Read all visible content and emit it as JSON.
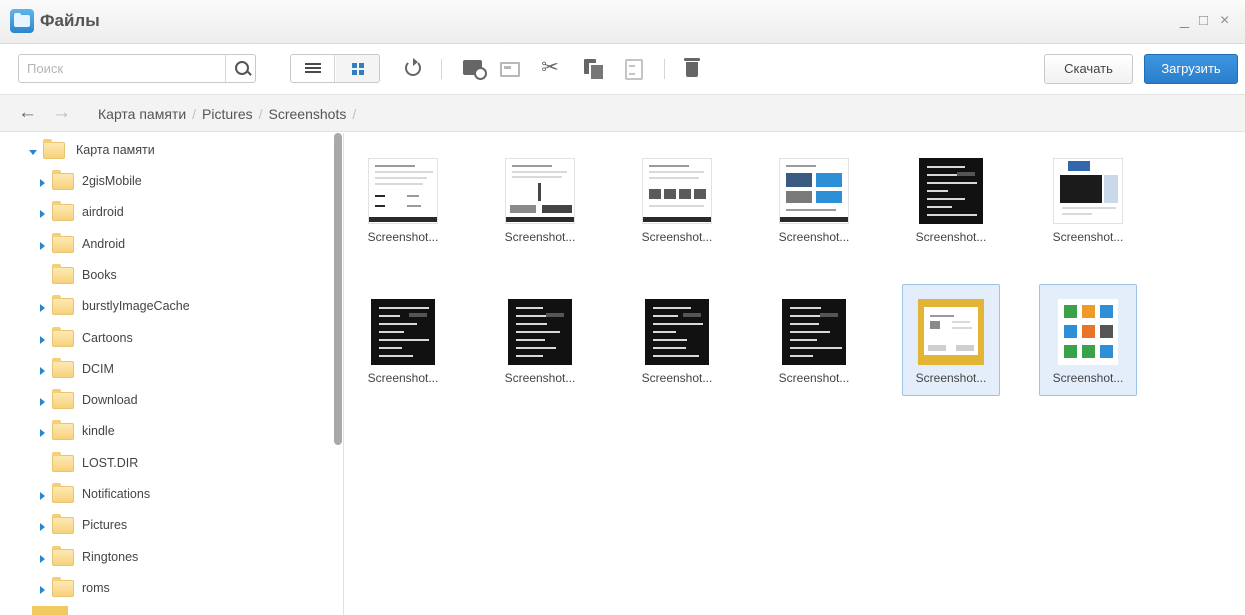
{
  "window": {
    "title": "Файлы",
    "minimize": "_",
    "maximize": "□",
    "close": "×"
  },
  "toolbar": {
    "search_placeholder": "Поиск",
    "download_label": "Скачать",
    "upload_label": "Загрузить",
    "cut_glyph": "✂"
  },
  "nav": {
    "back": "←",
    "forward": "→",
    "breadcrumb": [
      "Карта памяти",
      "Pictures",
      "Screenshots"
    ],
    "separator": "/"
  },
  "sidebar": {
    "root": "Карта памяти",
    "items": [
      {
        "label": "2gisMobile",
        "expandable": true
      },
      {
        "label": "airdroid",
        "expandable": true
      },
      {
        "label": "Android",
        "expandable": true
      },
      {
        "label": "Books",
        "expandable": false
      },
      {
        "label": "burstlyImageCache",
        "expandable": true
      },
      {
        "label": "Cartoons",
        "expandable": true
      },
      {
        "label": "DCIM",
        "expandable": true
      },
      {
        "label": "Download",
        "expandable": true
      },
      {
        "label": "kindle",
        "expandable": true
      },
      {
        "label": "LOST.DIR",
        "expandable": false
      },
      {
        "label": "Notifications",
        "expandable": true
      },
      {
        "label": "Pictures",
        "expandable": true
      },
      {
        "label": "Ringtones",
        "expandable": true
      },
      {
        "label": "roms",
        "expandable": true
      }
    ]
  },
  "files": [
    {
      "name": "Screenshot...",
      "style": "light",
      "selected": false
    },
    {
      "name": "Screenshot...",
      "style": "light",
      "selected": false
    },
    {
      "name": "Screenshot...",
      "style": "light",
      "selected": false
    },
    {
      "name": "Screenshot...",
      "style": "light",
      "selected": false
    },
    {
      "name": "Screenshot...",
      "style": "dark",
      "selected": false
    },
    {
      "name": "Screenshot...",
      "style": "light",
      "selected": false
    },
    {
      "name": "Screenshot...",
      "style": "dark",
      "selected": false
    },
    {
      "name": "Screenshot...",
      "style": "dark",
      "selected": false
    },
    {
      "name": "Screenshot...",
      "style": "dark",
      "selected": false
    },
    {
      "name": "Screenshot...",
      "style": "dark",
      "selected": false
    },
    {
      "name": "Screenshot...",
      "style": "yellow",
      "selected": true
    },
    {
      "name": "Screenshot...",
      "style": "apps",
      "selected": true
    }
  ],
  "colors": {
    "accent": "#2a86cc",
    "selection": "#e3eefa",
    "folder": "#f7d27c"
  }
}
